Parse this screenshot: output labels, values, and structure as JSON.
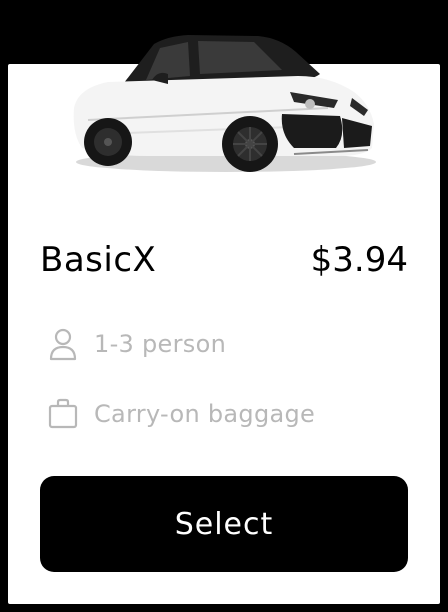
{
  "card": {
    "image": {
      "subject": "car-image"
    },
    "name": "BasicX",
    "price": "$3.94",
    "features": [
      {
        "icon": "person-icon",
        "label": "1-3 person"
      },
      {
        "icon": "bag-icon",
        "label": "Carry-on baggage"
      }
    ],
    "select_label": "Select"
  },
  "colors": {
    "background": "#000000",
    "card": "#ffffff",
    "button": "#000000",
    "muted_text": "#b8b8b8"
  }
}
